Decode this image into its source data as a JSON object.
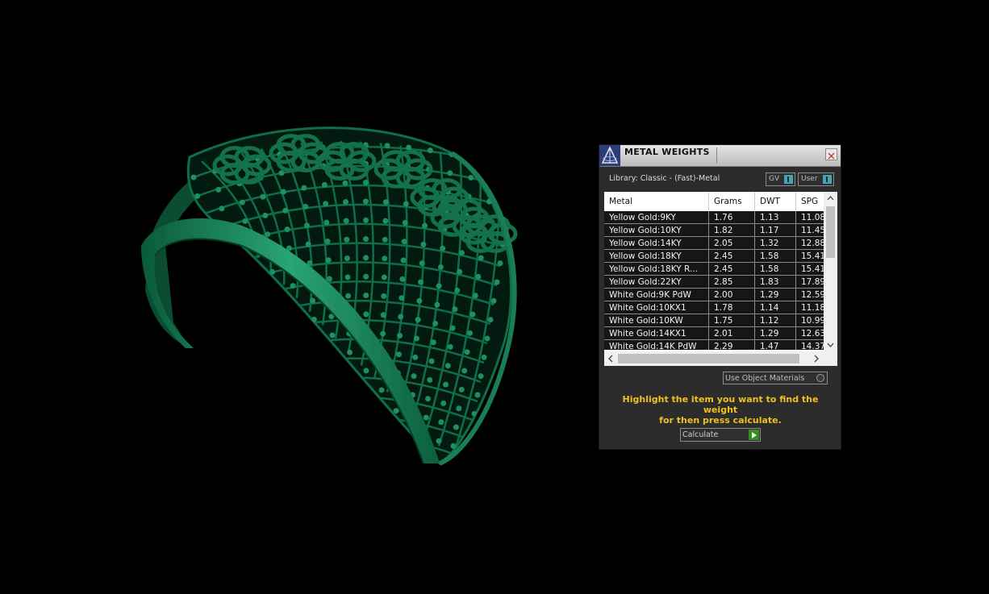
{
  "colors": {
    "model_green": "#0f6e4a",
    "panel_bg": "#2c2c2c",
    "hint_yellow": "#f0c020",
    "toggle_blue": "#48a2b0",
    "calc_green": "#3a8a2a"
  },
  "viewport": {
    "model": "ring-3d-model"
  },
  "panel": {
    "title": "METAL WEIGHTS",
    "close_icon": "close-icon",
    "library_label": "Library: Classic - (Fast)-Metal",
    "toggles": [
      {
        "label": "GV"
      },
      {
        "label": "User"
      }
    ],
    "table": {
      "columns": [
        "Metal",
        "Grams",
        "DWT",
        "SPG"
      ],
      "rows": [
        [
          "Yellow Gold:9KY",
          "1.76",
          "1.13",
          "11.08"
        ],
        [
          "Yellow Gold:10KY",
          "1.82",
          "1.17",
          "11.45"
        ],
        [
          "Yellow Gold:14KY",
          "2.05",
          "1.32",
          "12.88"
        ],
        [
          "Yellow Gold:18KY",
          "2.45",
          "1.58",
          "15.41"
        ],
        [
          "Yellow Gold:18KY R...",
          "2.45",
          "1.58",
          "15.41"
        ],
        [
          "Yellow Gold:22KY",
          "2.85",
          "1.83",
          "17.89"
        ],
        [
          "White Gold:9K PdW",
          "2.00",
          "1.29",
          "12.59"
        ],
        [
          "White Gold:10KX1",
          "1.78",
          "1.14",
          "11.18"
        ],
        [
          "White Gold:10KW",
          "1.75",
          "1.12",
          "10.99"
        ],
        [
          "White Gold:14KX1",
          "2.01",
          "1.29",
          "12.63"
        ],
        [
          "White Gold:14K PdW",
          "2.29",
          "1.47",
          "14.37"
        ]
      ]
    },
    "use_object_materials_label": "Use Object Materials",
    "hint_line1": "Highlight the item you want to find the weight",
    "hint_line2": "for then press calculate.",
    "calculate_label": "Calculate"
  }
}
